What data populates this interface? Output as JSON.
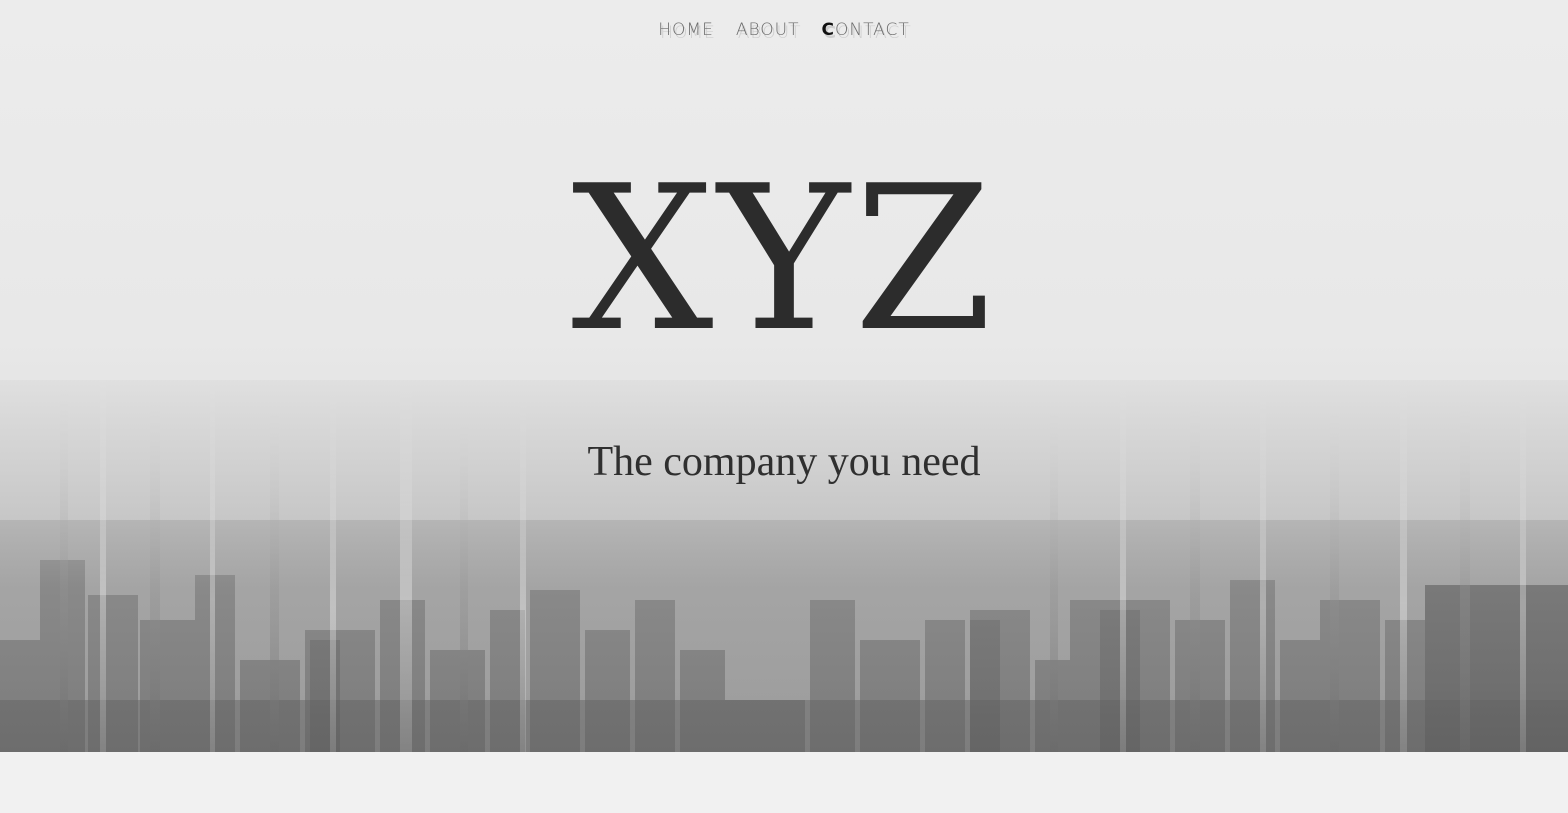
{
  "nav": {
    "items": [
      {
        "label": "HOME",
        "active": false
      },
      {
        "label": "ABOUT",
        "active": false
      },
      {
        "label": "CONTACT",
        "active": true
      }
    ]
  },
  "hero": {
    "brand": "XYZ",
    "tagline": "The company you need"
  },
  "colors": {
    "brand_text": "#2c2c2c",
    "nav_text": "#6b6b6b",
    "nav_active": "#111111",
    "page_bg": "#f1f1f1"
  }
}
